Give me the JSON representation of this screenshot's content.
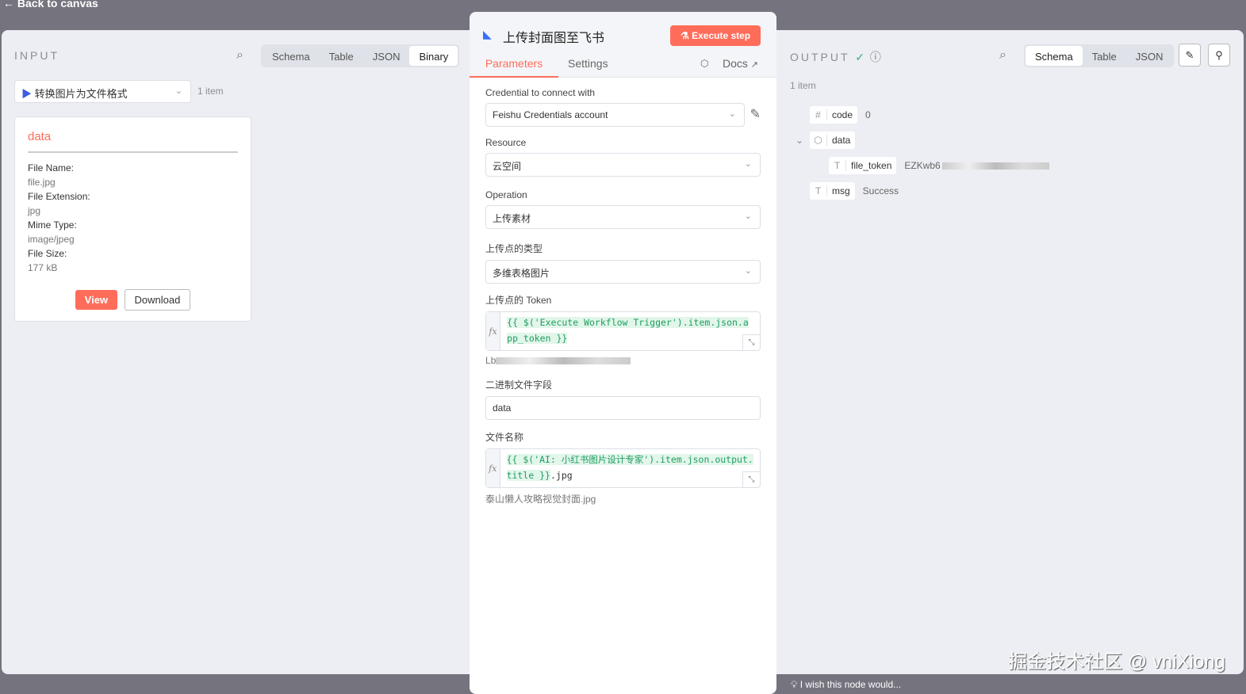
{
  "back": "Back to canvas",
  "input": {
    "title": "INPUT",
    "tabs": [
      "Schema",
      "Table",
      "JSON",
      "Binary"
    ],
    "active": "Binary",
    "node_select": "转换图片为文件格式",
    "count": "1 item",
    "card": {
      "title": "data",
      "fields": [
        {
          "k": "File Name:",
          "v": "file.jpg"
        },
        {
          "k": "File Extension:",
          "v": "jpg"
        },
        {
          "k": "Mime Type:",
          "v": "image/jpeg"
        },
        {
          "k": "File Size:",
          "v": "177 kB"
        }
      ],
      "view": "View",
      "download": "Download"
    }
  },
  "node": {
    "title": "上传封面图至飞书",
    "execute": "Execute step",
    "tabs": [
      "Parameters",
      "Settings"
    ],
    "docs": "Docs",
    "credential": {
      "label": "Credential to connect with",
      "value": "Feishu Credentials account"
    },
    "resource": {
      "label": "Resource",
      "value": "云空间"
    },
    "operation": {
      "label": "Operation",
      "value": "上传素材"
    },
    "parent_type": {
      "label": "上传点的类型",
      "value": "多维表格图片"
    },
    "token": {
      "label": "上传点的 Token",
      "expr": "{{ $('Execute Workflow Trigger').item.json.app_token }}",
      "hint": "Lb"
    },
    "binary_field": {
      "label": "二进制文件字段",
      "value": "data"
    },
    "filename": {
      "label": "文件名称",
      "expr": "{{ $('AI: 小红书图片设计专家').item.json.output.title }}",
      "suffix": ".jpg",
      "hint": "泰山懒人攻略视觉封面.jpg"
    }
  },
  "output": {
    "title": "OUTPUT",
    "tabs": [
      "Schema",
      "Table",
      "JSON"
    ],
    "active": "Schema",
    "count": "1 item",
    "rows": [
      {
        "type": "#",
        "name": "code",
        "value": "0"
      },
      {
        "type": "cube",
        "name": "data",
        "value": ""
      },
      {
        "type": "T",
        "name": "file_token",
        "value": "EZKwb6"
      },
      {
        "type": "T",
        "name": "msg",
        "value": "Success"
      }
    ]
  },
  "footer": {
    "wish": "I wish this node would..."
  },
  "watermark": "掘金技术社区 @ vniXiong"
}
